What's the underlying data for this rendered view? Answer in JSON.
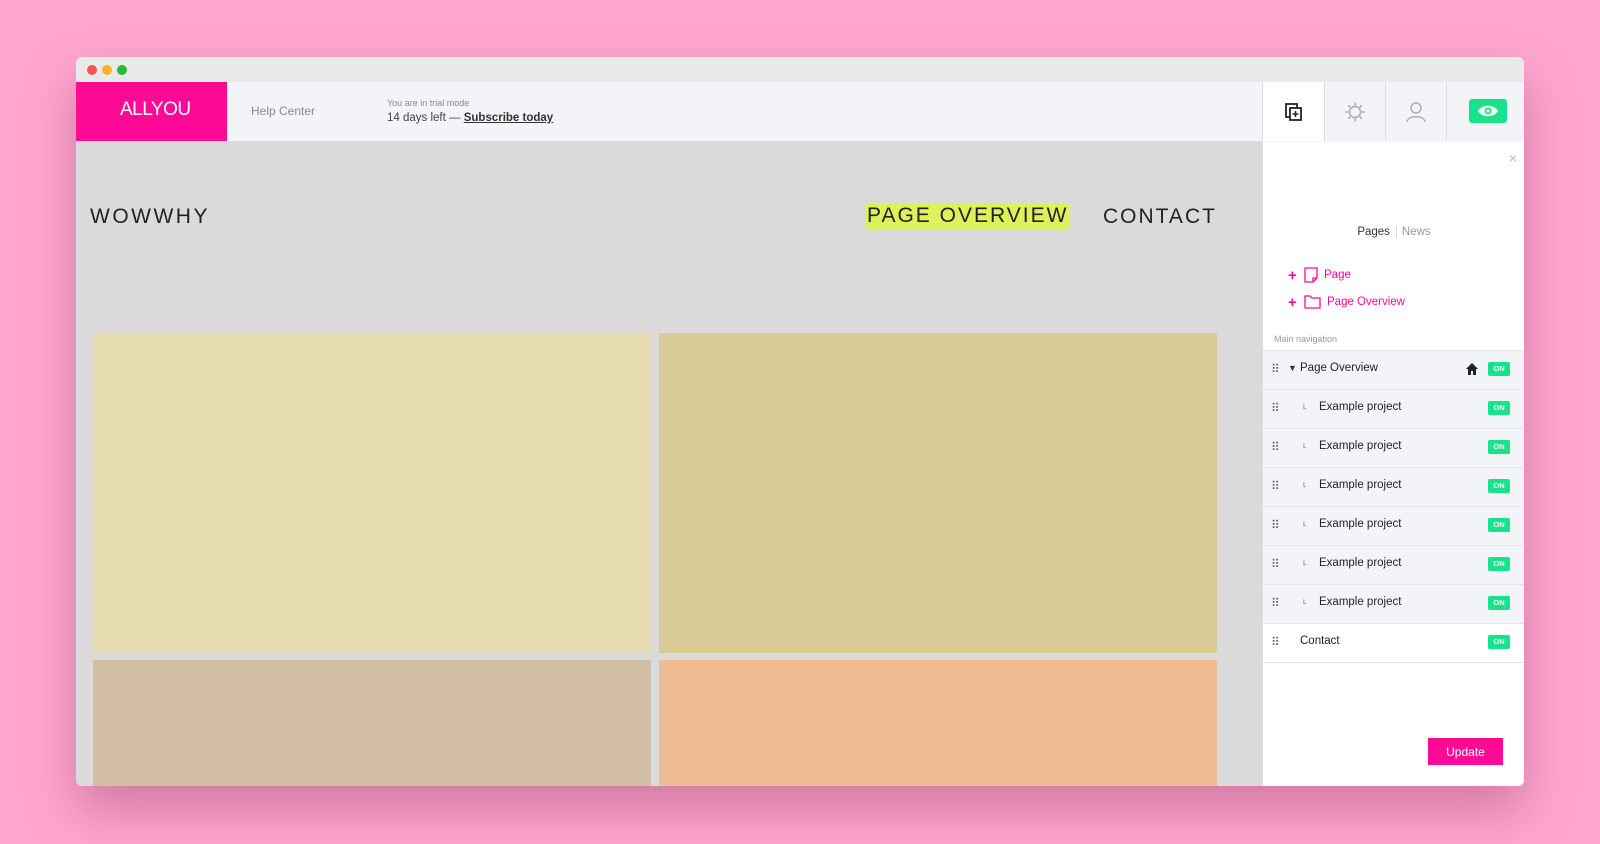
{
  "brand": {
    "logo_text": "ALLYOU",
    "accent": "#ff0a96",
    "on_color": "#16e38a"
  },
  "header": {
    "help_link": "Help Center",
    "trial_notice": "You are in trial mode",
    "trial_days": "14 days left —",
    "subscribe_link": "Subscribe today"
  },
  "toolbar": {
    "icons": [
      "pages-icon",
      "settings-icon",
      "user-icon",
      "preview-eye-icon"
    ]
  },
  "site": {
    "title": "WOWWHY",
    "nav": {
      "overview": "PAGE OVERVIEW",
      "contact": "CONTACT"
    },
    "highlight_color": "#ddf25a",
    "tile_colors": [
      "#e8dcb3",
      "#d8cb93",
      "#d1bea4",
      "#f1bb93"
    ]
  },
  "panel": {
    "close": "×",
    "tabs": {
      "pages": "Pages",
      "news": "News"
    },
    "add_page": "Page",
    "add_overview": "Page Overview",
    "section_label": "Main navigation",
    "on_label": "ON",
    "nav_items": [
      {
        "label": "Page Overview",
        "level": 0,
        "status": "ON",
        "home": true
      },
      {
        "label": "Example project",
        "level": 1,
        "status": "ON"
      },
      {
        "label": "Example project",
        "level": 1,
        "status": "ON"
      },
      {
        "label": "Example project",
        "level": 1,
        "status": "ON"
      },
      {
        "label": "Example project",
        "level": 1,
        "status": "ON"
      },
      {
        "label": "Example project",
        "level": 1,
        "status": "ON"
      },
      {
        "label": "Example project",
        "level": 1,
        "status": "ON"
      },
      {
        "label": "Contact",
        "level": 0,
        "status": "ON"
      }
    ],
    "update_button": "Update"
  }
}
